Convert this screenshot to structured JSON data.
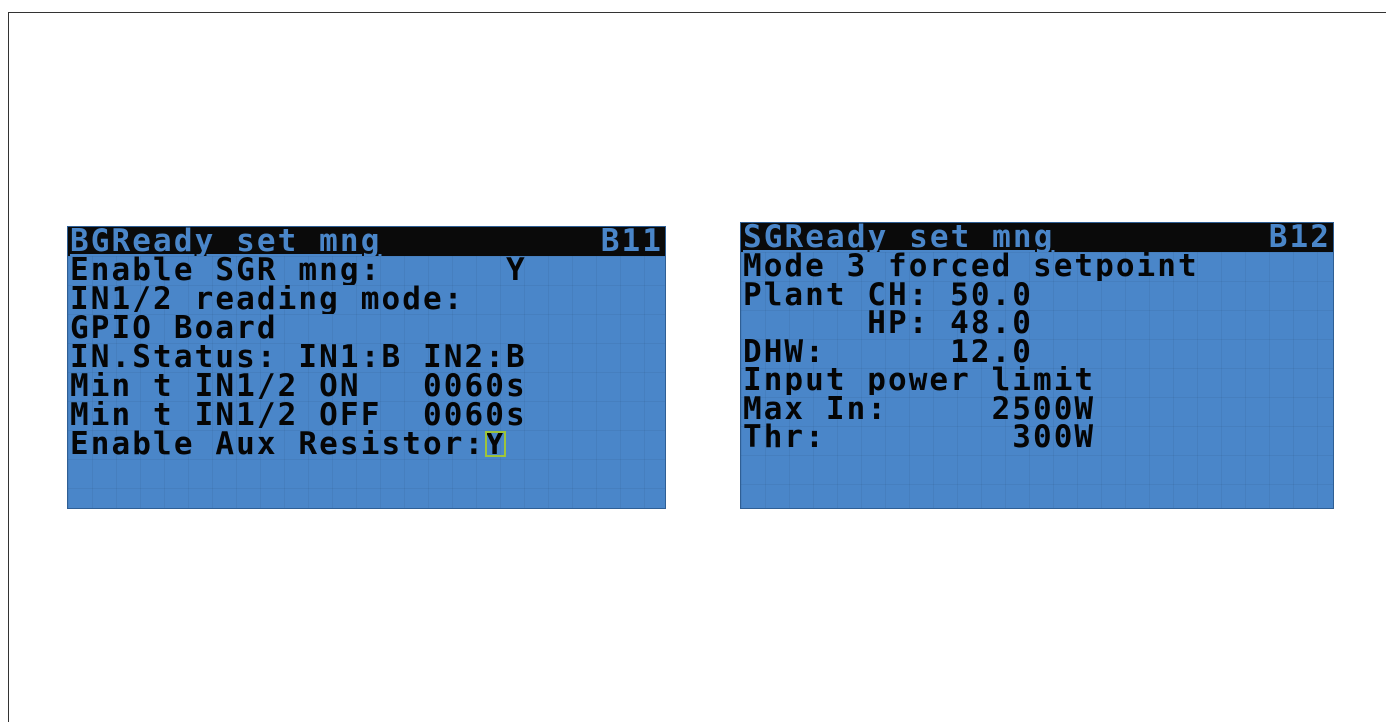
{
  "left_panel": {
    "title": "BGReady set mng",
    "page_id": "B11",
    "lines": [
      "Enable SGR mng:      Y",
      "IN1/2 reading mode:",
      "GPIO Board",
      "IN.Status: IN1:B IN2:B",
      "Min t IN1/2 ON   0060s",
      "Min t IN1/2 OFF  0060s"
    ],
    "last_line_label": "Enable Aux Resistor:",
    "last_line_value": "Y"
  },
  "right_panel": {
    "title": "SGReady set mng",
    "page_id": "B12",
    "lines": [
      "Mode 3 forced setpoint",
      "Plant CH: 50.0",
      "      HP: 48.0",
      "DHW:      12.0",
      "Input power limit",
      "Max In:     2500W",
      "Thr:         300W"
    ]
  },
  "colors": {
    "lcd_background": "#4a86c9",
    "lcd_text": "#050505",
    "title_bar": "#0a0a0a",
    "cursor_outline": "#9ec43a"
  }
}
